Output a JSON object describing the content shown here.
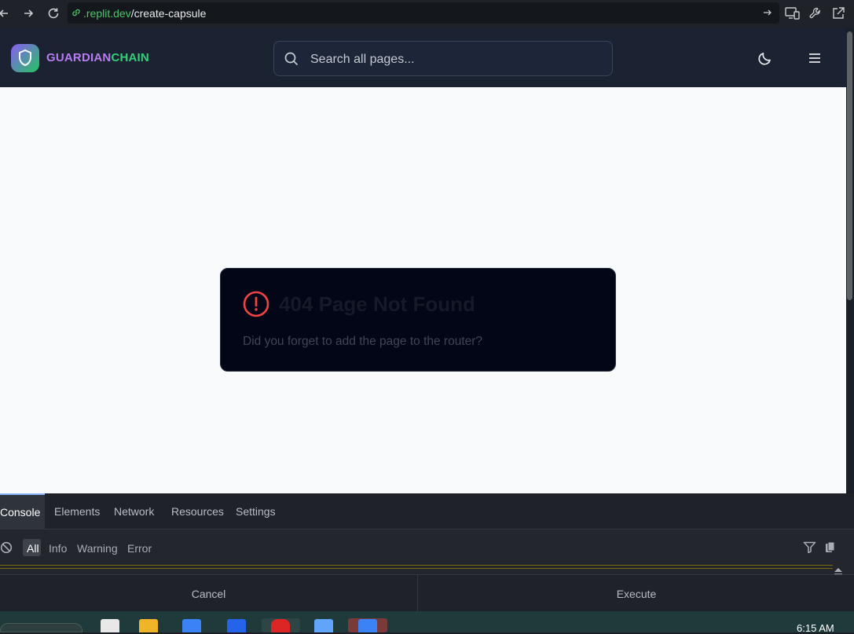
{
  "browser": {
    "url_host": ".replit.dev",
    "url_path": "/create-capsule"
  },
  "header": {
    "brand_part1": "GUARDIAN",
    "brand_part2": "CHAIN",
    "search_placeholder": "Search all pages..."
  },
  "error_card": {
    "title": "404 Page Not Found",
    "message": "Did you forget to add the page to the router?"
  },
  "devtools": {
    "tabs": [
      "Console",
      "Elements",
      "Network",
      "Resources",
      "Settings"
    ],
    "filters": [
      "All",
      "Info",
      "Warning",
      "Error"
    ],
    "cancel_label": "Cancel",
    "execute_label": "Execute"
  },
  "taskbar": {
    "time": "6:15 AM"
  },
  "colors": {
    "brand_purple": "#b97cf3",
    "brand_green": "#34d078",
    "error_red": "#ef4444",
    "url_green": "#4ec36b"
  }
}
